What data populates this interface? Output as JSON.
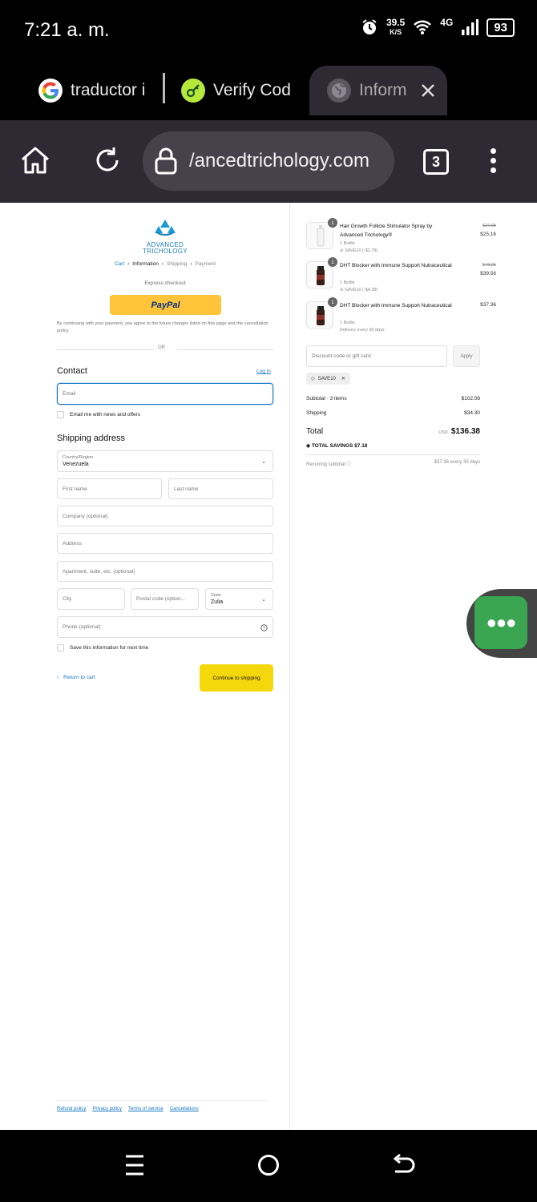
{
  "status_bar": {
    "time": "7:21 a. m.",
    "speed_value": "39.5",
    "speed_unit": "K/S",
    "network": "4G",
    "battery": "93"
  },
  "browser": {
    "tabs": [
      {
        "label": "traductor i"
      },
      {
        "label": "Verify Cod"
      },
      {
        "label": "Inform"
      }
    ],
    "url": "/ancedtrichology.com",
    "tab_count": "3"
  },
  "checkout": {
    "logo_line1": "ADVANCED",
    "logo_line2": "TRICHOLOGY",
    "breadcrumb": [
      "Cart",
      "Information",
      "Shipping",
      "Payment"
    ],
    "express_checkout": "Express checkout",
    "paypal_label": "PayPal",
    "terms_text": "By continuing with your payment, you agree to the future charges listed on this page and the cancellation policy.",
    "or_label": "OR",
    "contact_title": "Contact",
    "login_link": "Log in",
    "email_placeholder": "Email",
    "news_label": "Email me with news and offers",
    "shipping_title": "Shipping address",
    "country_label": "Country/Region",
    "country_value": "Venezuela",
    "first_name": "First name",
    "last_name": "Last name",
    "company": "Company (optional)",
    "address": "Address",
    "apartment": "Apartment, suite, etc. (optional)",
    "city": "City",
    "postal": "Postal code (option...",
    "state_label": "State",
    "state_value": "Zulia",
    "phone": "Phone (optional)",
    "save_label": "Save this information for next time",
    "return_label": "Return to cart",
    "continue_label": "Continue to shipping",
    "footer_links": [
      "Refund policy",
      "Privacy policy",
      "Terms of service",
      "Cancellations"
    ]
  },
  "summary": {
    "items": [
      {
        "qty": "1",
        "name": "Hair Growth Follicle Stimulator Spray by Advanced Trichology®",
        "variant": "1 Bottle",
        "note": "SAVE10 (-$2.79)",
        "old_price": "$27.95",
        "price": "$25.16"
      },
      {
        "qty": "1",
        "name": "DHT Blocker with Immune Support Nutraceutical",
        "variant": "1 Bottle",
        "note": "SAVE10 (-$4.39)",
        "old_price": "$43.95",
        "price": "$39.56"
      },
      {
        "qty": "1",
        "name": "DHT Blocker with Immune Support Nutraceutical",
        "variant": "1 Bottle",
        "note": "Delivery every 30 days",
        "old_price": "",
        "price": "$37.36"
      }
    ],
    "discount_placeholder": "Discount code or gift card",
    "apply_label": "Apply",
    "code": "SAVE10",
    "subtotal_label": "Subtotal · 3 items",
    "subtotal_value": "$102.08",
    "shipping_label": "Shipping",
    "shipping_value": "$34.30",
    "total_label": "Total",
    "currency": "USD",
    "total_value": "$136.38",
    "savings_label": "TOTAL SAVINGS",
    "savings_value": "$7.18",
    "recurring_label": "Recurring subtotal",
    "recurring_value": "$37.36 every 30 days"
  },
  "colors": {
    "accent": "#1877c2",
    "paypal": "#ffc439",
    "continue": "#f5d80c",
    "chat": "#3aa652"
  }
}
